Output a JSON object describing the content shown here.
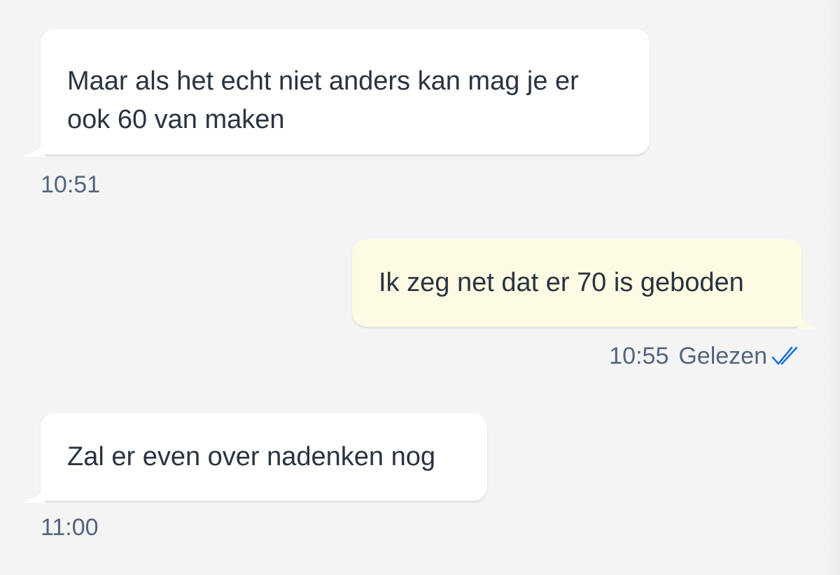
{
  "messages": [
    {
      "direction": "incoming",
      "text": "Maar als het echt niet anders kan mag je er ook 60 van maken",
      "time": "10:51"
    },
    {
      "direction": "outgoing",
      "text": "Ik zeg net dat er 70 is geboden",
      "time": "10:55",
      "status": "Gelezen",
      "status_icon": "double-check-icon"
    },
    {
      "direction": "incoming",
      "text": "Zal er even over nadenken nog",
      "time": "11:00"
    }
  ],
  "colors": {
    "background": "#f4f4f5",
    "incoming_bubble": "#ffffff",
    "outgoing_bubble": "#fdfbe3",
    "text": "#2a3340",
    "meta_text": "#53657c",
    "read_check": "#1f6fe0"
  }
}
